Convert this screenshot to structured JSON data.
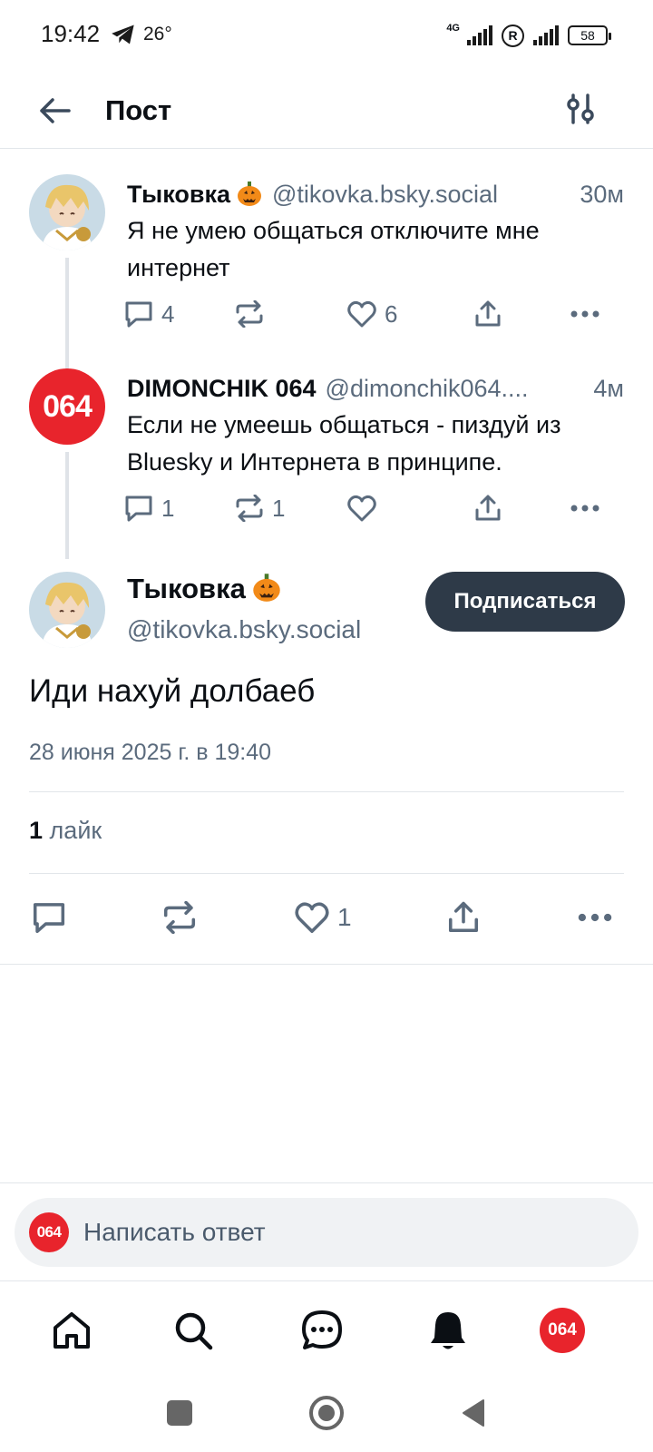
{
  "status_bar": {
    "time": "19:42",
    "temperature": "26°",
    "network": "4G",
    "battery": "58",
    "registered_symbol": "R"
  },
  "header": {
    "title": "Пост"
  },
  "thread": [
    {
      "author_name": "Тыковка",
      "author_emoji": "🎃",
      "handle": "@tikovka.bsky.social",
      "time": "30м",
      "text": "Я не умею общаться отключите мне интернет",
      "reply_count": "4",
      "repost_count": "",
      "like_count": "6"
    },
    {
      "author_name": "DIMONCHIK 064",
      "avatar_text": "064",
      "handle": "@dimonchik064....",
      "time": "4м",
      "text": "Если не умеешь общаться - пиздуй из Bluesky и Интернета в принципе.",
      "reply_count": "1",
      "repost_count": "1",
      "like_count": ""
    }
  ],
  "main_post": {
    "author_name": "Тыковка",
    "author_emoji": "🎃",
    "handle": "@tikovka.bsky.social",
    "follow_label": "Подписаться",
    "text": "Иди нахуй долбаеб",
    "date": "28 июня 2025 г. в 19:40",
    "likes_count": "1",
    "likes_label": "лайк",
    "like_count": "1"
  },
  "composer": {
    "avatar_text": "064",
    "placeholder": "Написать ответ"
  },
  "bottom_nav": {
    "items": [
      "home",
      "search",
      "chat",
      "notifications",
      "profile"
    ],
    "profile_avatar_text": "064"
  },
  "colors": {
    "accent_red": "#e8242c",
    "follow_button": "#2e3a48",
    "muted_text": "#5b6b7d"
  }
}
